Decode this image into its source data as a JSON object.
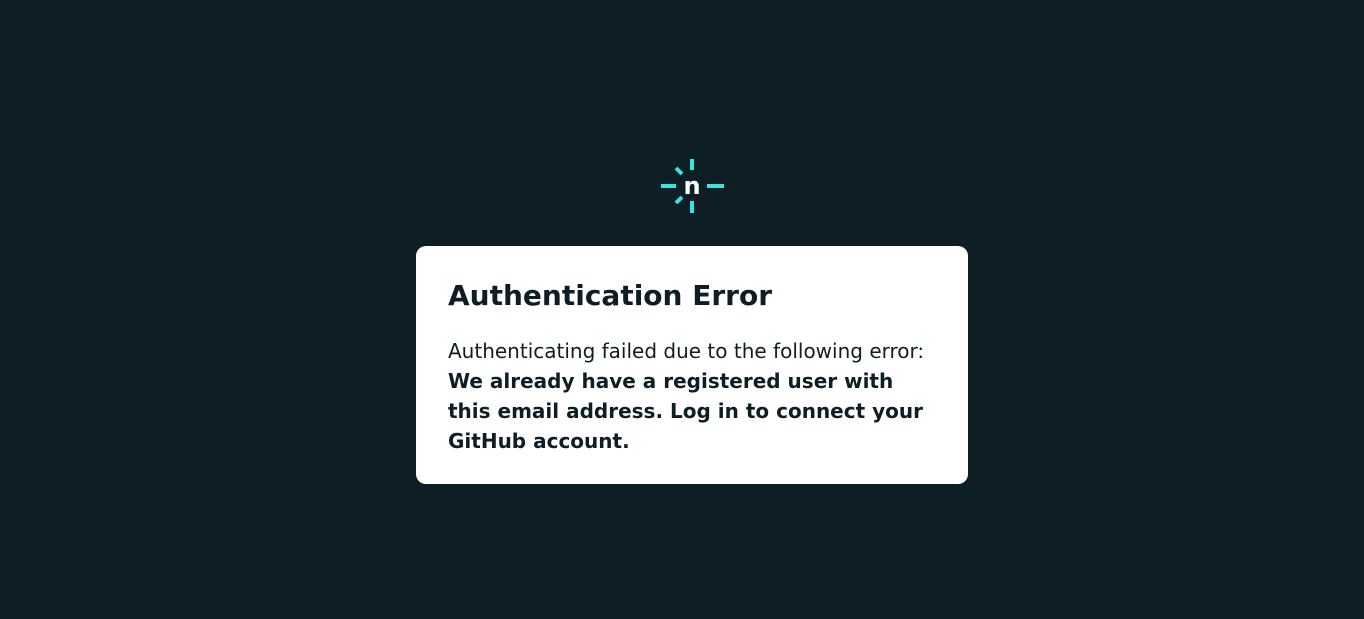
{
  "colors": {
    "background": "#0e1e25",
    "card": "#ffffff",
    "accent": "#32e6e2",
    "text": "#0e1e25"
  },
  "logo": {
    "icon": "netlify-logo-icon",
    "letter": "n"
  },
  "error": {
    "title": "Authentication Error",
    "intro": "Authenticating failed due to the following error:",
    "message": "We already have a registered user with this email address. Log in to connect your GitHub account."
  }
}
